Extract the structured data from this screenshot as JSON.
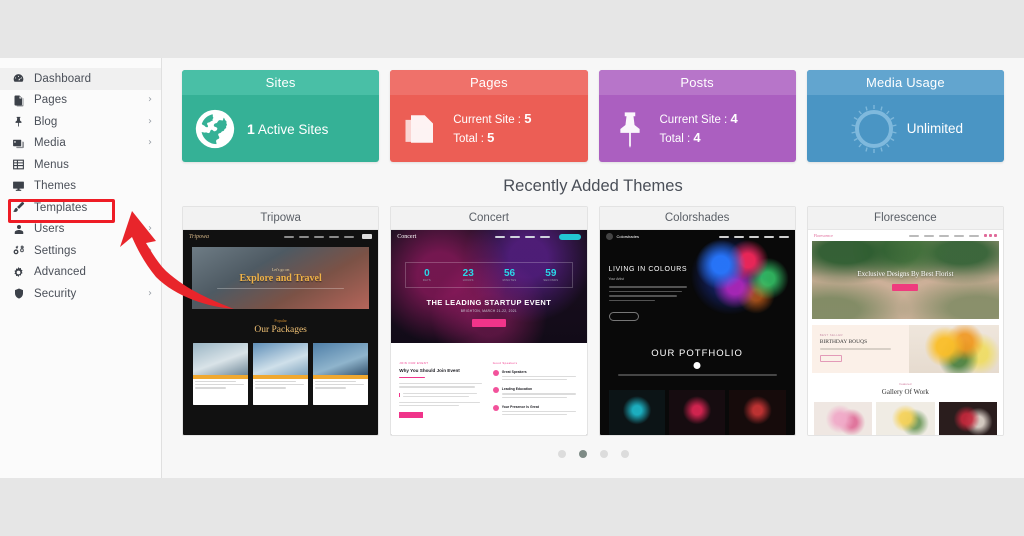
{
  "sidebar": {
    "items": [
      {
        "label": "Dashboard",
        "icon": "dashboard-icon",
        "chevron": false,
        "active": true
      },
      {
        "label": "Pages",
        "icon": "pages-icon",
        "chevron": true,
        "active": false
      },
      {
        "label": "Blog",
        "icon": "pin-icon",
        "chevron": true,
        "active": false
      },
      {
        "label": "Media",
        "icon": "media-icon",
        "chevron": true,
        "active": false
      },
      {
        "label": "Menus",
        "icon": "menus-icon",
        "chevron": false,
        "active": false
      },
      {
        "label": "Themes",
        "icon": "monitor-icon",
        "chevron": false,
        "active": false
      },
      {
        "label": "Templates",
        "icon": "brush-icon",
        "chevron": false,
        "active": false
      },
      {
        "label": "Users",
        "icon": "user-icon",
        "chevron": true,
        "active": false
      },
      {
        "label": "Settings",
        "icon": "gears-icon",
        "chevron": true,
        "active": false
      },
      {
        "label": "Advanced",
        "icon": "gear-icon",
        "chevron": false,
        "active": false
      },
      {
        "label": "Security",
        "icon": "shield-icon",
        "chevron": true,
        "active": false
      }
    ],
    "chevron_glyph": "›",
    "highlighted_item": "Templates"
  },
  "annotation": {
    "highlight_color": "#ee1c25",
    "arrow_color": "#e8252b",
    "points_to": "Templates"
  },
  "stats": [
    {
      "title": "Sites",
      "icon": "globe-icon",
      "accent": "#35b196",
      "header_accent": "#49bfa6",
      "big_value": "1",
      "big_label": "Active Sites",
      "rows": []
    },
    {
      "title": "Pages",
      "icon": "pages-stack-icon",
      "accent": "#ec5e55",
      "header_accent": "#ef716a",
      "rows": [
        {
          "label": "Current Site :",
          "value": "5"
        },
        {
          "label": "Total :",
          "value": "5"
        }
      ]
    },
    {
      "title": "Posts",
      "icon": "pin-icon",
      "accent": "#ab5fc0",
      "header_accent": "#b775c9",
      "rows": [
        {
          "label": "Current Site :",
          "value": "4"
        },
        {
          "label": "Total :",
          "value": "4"
        }
      ]
    },
    {
      "title": "Media Usage",
      "icon": "progress-ring-icon",
      "accent": "#4a95c4",
      "header_accent": "#62a5cf",
      "ring_value": "Unlimited",
      "rows": []
    }
  ],
  "themes_section": {
    "title": "Recently Added Themes",
    "themes": [
      {
        "name": "Tripowa",
        "preview": {
          "logo": "Tripowa",
          "hero_kicker": "Let's go on",
          "hero_title": "Explore and Travel",
          "section_kicker": "Popular",
          "section_title": "Our Packages",
          "cards": 3
        }
      },
      {
        "name": "Concert",
        "preview": {
          "logo": "Concert",
          "cta": "BUY TICKETS",
          "countdown": [
            {
              "value": "0",
              "label": "DAYS"
            },
            {
              "value": "23",
              "label": "HOURS"
            },
            {
              "value": "56",
              "label": "MINUTES"
            },
            {
              "value": "59",
              "label": "SECONDS"
            }
          ],
          "hero_title": "THE LEADING STARTUP EVENT",
          "hero_date": "BRIGHTON, MARCH 21-22, 2021",
          "lower_kicker": "JOIN OUR EVENT",
          "lower_title": "Why You Should Join Event",
          "features_kicker": "Good Speakers",
          "features": [
            "Great Speakers",
            "Leading Education",
            "Your Presence Is Great"
          ]
        }
      },
      {
        "name": "Colorshades",
        "preview": {
          "logo": "Colorshades",
          "hero_title": "LIVING IN COLOURS",
          "hero_sub": "Your Artist",
          "section_title": "OUR POTFHOLIO",
          "gallery_items": 3
        }
      },
      {
        "name": "Florescence",
        "preview": {
          "logo": "Florescence",
          "hero_title": "Exclusive Designs By Best Florist",
          "hero_button": "ORDER NOW",
          "band_kicker": "BEST SELLER",
          "band_title": "BIRTHDAY BOUQS",
          "band_button": "SHOP NOW",
          "gallery_kicker": "Featured",
          "gallery_title": "Gallery Of Work",
          "gallery_items": 3
        }
      }
    ]
  },
  "pagination": {
    "dots": 4,
    "active_index": 1
  }
}
